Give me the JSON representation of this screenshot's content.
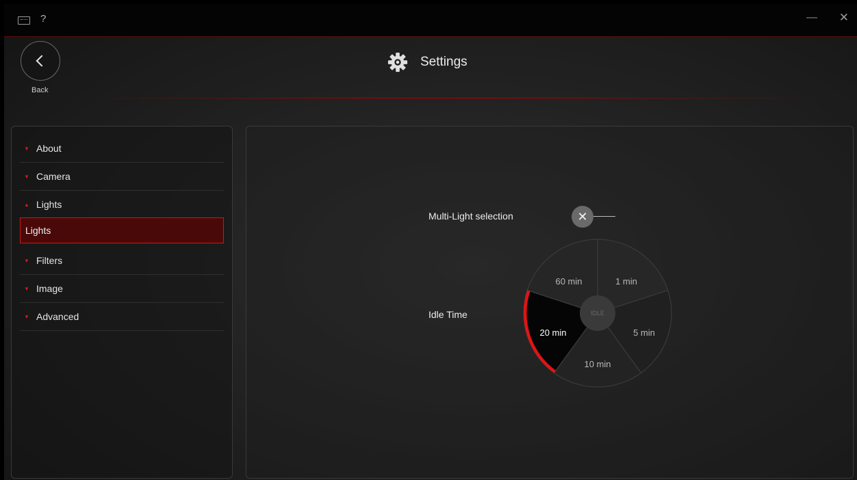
{
  "titlebar": {
    "help_label": "?",
    "minimize_label": "—",
    "close_label": "✕"
  },
  "header": {
    "back_label": "Back",
    "title": "Settings"
  },
  "sidebar": {
    "items": [
      {
        "label": "About"
      },
      {
        "label": "Camera"
      },
      {
        "label": "Lights",
        "expanded": true
      },
      {
        "label": "Filters"
      },
      {
        "label": "Image"
      },
      {
        "label": "Advanced"
      }
    ],
    "sub_items": [
      {
        "label": "Lights",
        "selected": true
      }
    ]
  },
  "settings": {
    "multi_light_label": "Multi-Light selection",
    "multi_light_toggle_glyph": "✕",
    "idle_time_label": "Idle Time",
    "idle_dial": {
      "center_label": "IDLE",
      "options": [
        "1 min",
        "5 min",
        "10 min",
        "20 min",
        "60 min"
      ],
      "selected": "20 min"
    }
  },
  "colors": {
    "accent": "#c31b1b",
    "accent_dark": "#4a0909",
    "background": "#1c1c1c"
  }
}
